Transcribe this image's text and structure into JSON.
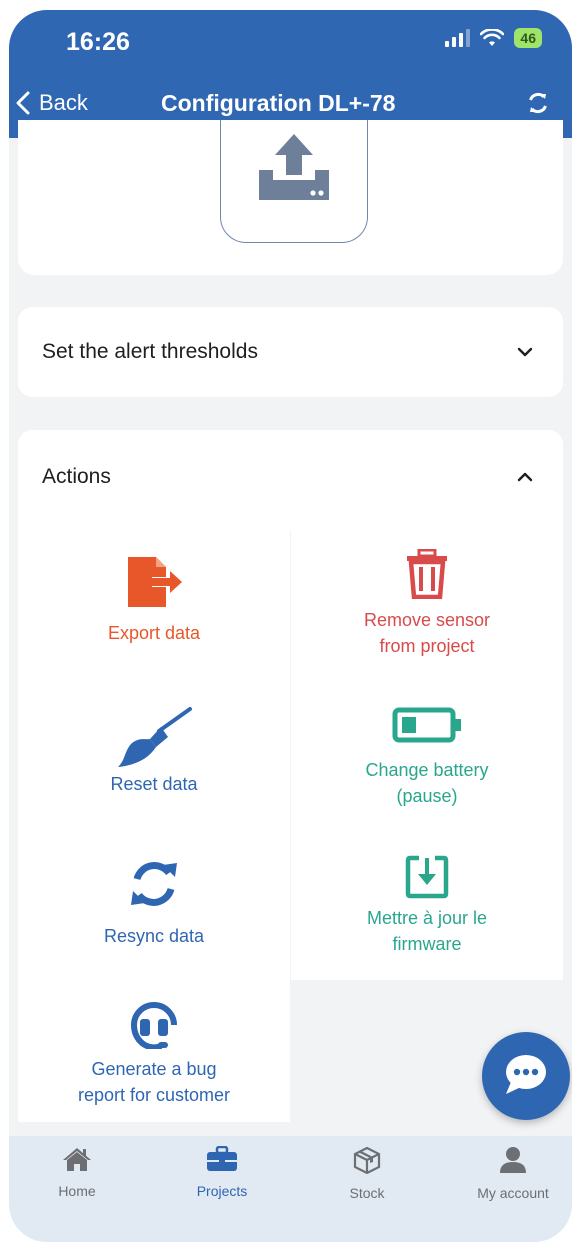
{
  "status": {
    "time": "16:26",
    "battery": "46"
  },
  "nav": {
    "back_label": "Back",
    "title": "Configuration DL+-78"
  },
  "sections": {
    "alerts_label": "Set the alert thresholds",
    "actions_label": "Actions"
  },
  "actions": {
    "export": "Export data",
    "remove_line1": "Remove sensor",
    "remove_line2": "from project",
    "reset": "Reset data",
    "battery_line1": "Change battery",
    "battery_line2": "(pause)",
    "resync": "Resync data",
    "firmware_line1": "Mettre à jour le",
    "firmware_line2": "firmware",
    "bug_line1": "Generate a bug",
    "bug_line2": "report for customer"
  },
  "tabs": [
    {
      "label": "Home",
      "icon": "home-icon"
    },
    {
      "label": "Projects",
      "icon": "briefcase-icon"
    },
    {
      "label": "Stock",
      "icon": "box-icon"
    },
    {
      "label": "My account",
      "icon": "user-icon"
    }
  ],
  "colors": {
    "primary": "#3067b3",
    "export": "#e8572a",
    "remove": "#d94a4a",
    "teal": "#2aa68d",
    "blue_action": "#2f66b2"
  }
}
